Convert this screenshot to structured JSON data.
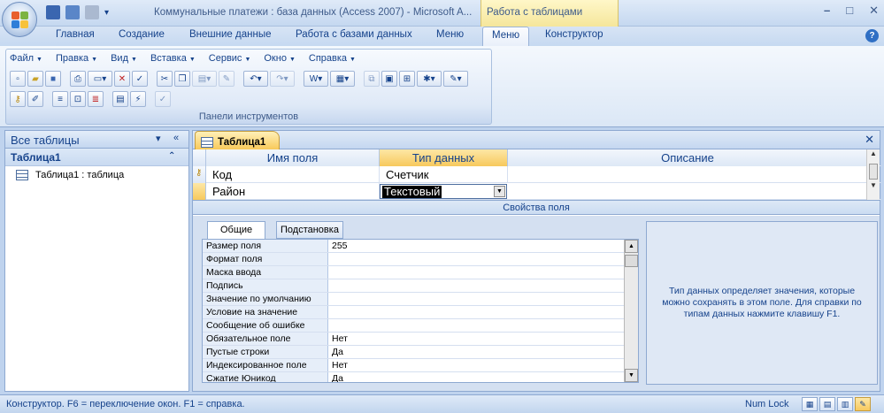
{
  "window": {
    "title": "Коммунальные платежи : база данных (Access 2007) - Microsoft A...",
    "context_tab_header": "Работа с таблицами",
    "controls": [
      "minimize",
      "maximize",
      "close"
    ]
  },
  "ribbon_tabs": [
    {
      "label": "Главная",
      "active": false
    },
    {
      "label": "Создание",
      "active": false
    },
    {
      "label": "Внешние данные",
      "active": false
    },
    {
      "label": "Работа с базами данных",
      "active": false
    },
    {
      "label": "Меню",
      "active": false
    },
    {
      "label": "Меню",
      "active": true
    },
    {
      "label": "Конструктор",
      "active": false
    }
  ],
  "toolbar_group": {
    "menus": [
      "Файл",
      "Правка",
      "Вид",
      "Вставка",
      "Сервис",
      "Окно",
      "Справка"
    ],
    "label": "Панели инструментов"
  },
  "nav_pane": {
    "header": "Все таблицы",
    "group": "Таблица1",
    "items": [
      "Таблица1 : таблица"
    ]
  },
  "document": {
    "tab_title": "Таблица1",
    "columns": [
      "Имя поля",
      "Тип данных",
      "Описание"
    ],
    "rows": [
      {
        "name": "Код",
        "type": "Счетчик",
        "description": "",
        "primary_key": true
      },
      {
        "name": "Район",
        "type": "Текстовый",
        "description": "",
        "primary_key": false
      }
    ],
    "properties_title": "Свойства поля",
    "property_tabs": [
      "Общие",
      "Подстановка"
    ],
    "properties": [
      {
        "label": "Размер поля",
        "value": "255"
      },
      {
        "label": "Формат поля",
        "value": ""
      },
      {
        "label": "Маска ввода",
        "value": ""
      },
      {
        "label": "Подпись",
        "value": ""
      },
      {
        "label": "Значение по умолчанию",
        "value": ""
      },
      {
        "label": "Условие на значение",
        "value": ""
      },
      {
        "label": "Сообщение об ошибке",
        "value": ""
      },
      {
        "label": "Обязательное поле",
        "value": "Нет"
      },
      {
        "label": "Пустые строки",
        "value": "Да"
      },
      {
        "label": "Индексированное поле",
        "value": "Нет"
      },
      {
        "label": "Сжатие Юникод",
        "value": "Да"
      }
    ],
    "hint": "Тип данных определяет значения, которые можно сохранять в этом поле.  Для справки по типам данных нажмите клавишу F1."
  },
  "status_bar": {
    "text": "Конструктор.  F6 = переключение окон.  F1 = справка.",
    "num_lock": "Num Lock"
  }
}
